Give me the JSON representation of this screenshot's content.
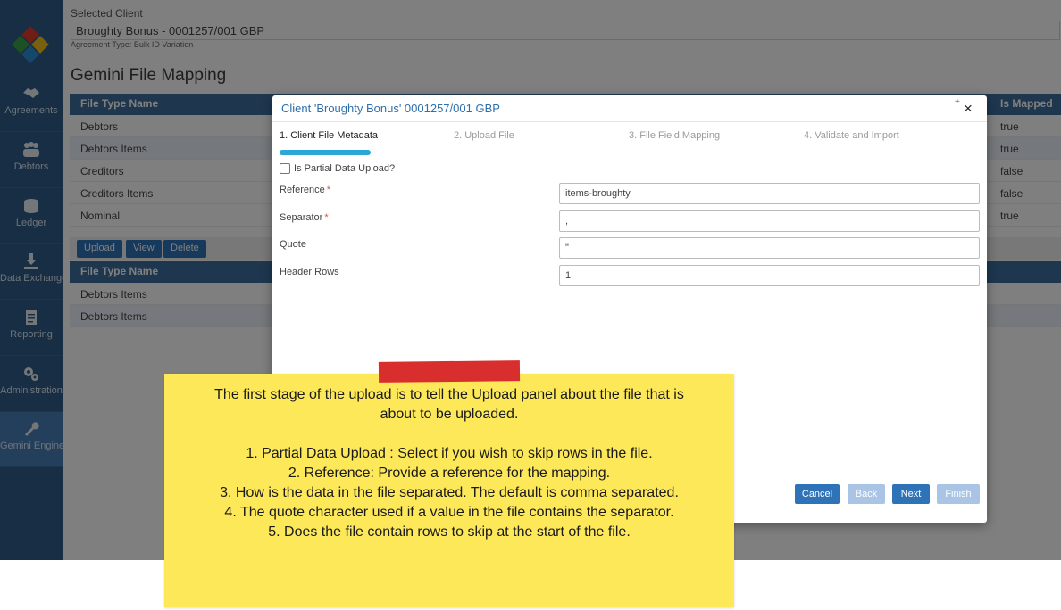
{
  "sidebar": {
    "items": [
      {
        "label": "Agreements",
        "icon": "handshake-icon"
      },
      {
        "label": "Debtors",
        "icon": "people-icon"
      },
      {
        "label": "Ledger",
        "icon": "coins-icon"
      },
      {
        "label": "Data Exchange",
        "icon": "download-icon"
      },
      {
        "label": "Reporting",
        "icon": "document-icon"
      },
      {
        "label": "Administration",
        "icon": "gears-icon"
      },
      {
        "label": "Gemini Engine",
        "icon": "wrench-icon"
      }
    ]
  },
  "header": {
    "selected_client_label": "Selected Client",
    "selected_client_value": "Broughty Bonus - 0001257/001 GBP",
    "agreement_type": "Agreement Type: Bulk ID Variation"
  },
  "page": {
    "title": "Gemini File Mapping"
  },
  "mapping_grid": {
    "col_name": "File Type Name",
    "col_mapped": "Is Mapped",
    "rows": [
      {
        "name": "Debtors",
        "mapped": "true"
      },
      {
        "name": "Debtors Items",
        "mapped": "true"
      },
      {
        "name": "Creditors",
        "mapped": "false"
      },
      {
        "name": "Creditors Items",
        "mapped": "false"
      },
      {
        "name": "Nominal",
        "mapped": "true"
      }
    ]
  },
  "toolbar": {
    "upload": "Upload",
    "view": "View",
    "delete": "Delete"
  },
  "files_grid": {
    "col_name": "File Type Name",
    "rows": [
      {
        "name": "Debtors Items"
      },
      {
        "name": "Debtors Items"
      }
    ]
  },
  "modal": {
    "title": "Client 'Broughty Bonus' 0001257/001 GBP",
    "close": "×",
    "plus": "+",
    "steps": [
      "1. Client File Metadata",
      "2. Upload File",
      "3. File Field Mapping",
      "4. Validate and Import"
    ],
    "partial_upload_label": "Is Partial Data Upload?",
    "partial_upload_checked": false,
    "fields": {
      "reference_label": "Reference",
      "reference_value": "items-broughty",
      "separator_label": "Separator",
      "separator_value": ",",
      "quote_label": "Quote",
      "quote_value": "\"",
      "header_rows_label": "Header Rows",
      "header_rows_value": "1",
      "required_mark": "*"
    },
    "buttons": {
      "cancel": "Cancel",
      "back": "Back",
      "next": "Next",
      "finish": "Finish"
    }
  },
  "note": {
    "lines": [
      "The first stage of the upload is to tell the Upload panel about the file that is",
      "about to be uploaded.",
      "",
      "1.  Partial Data Upload : Select if you wish to skip rows in the file.",
      "2. Reference: Provide a reference for the mapping.",
      "3. How is the data in the file separated.  The default is comma separated.",
      "4. The quote character used if a value in the file contains the separator.",
      "5.  Does the file contain rows to skip at the start of the file."
    ]
  },
  "colors": {
    "sidebar": "#2e5d8a",
    "grid_header": "#3c6e9f",
    "primary_button": "#2e72b8",
    "disabled_button": "#a9c4e4",
    "step_progress": "#2ba6d6",
    "note": "#fde85a",
    "tape": "#d92e2e"
  }
}
